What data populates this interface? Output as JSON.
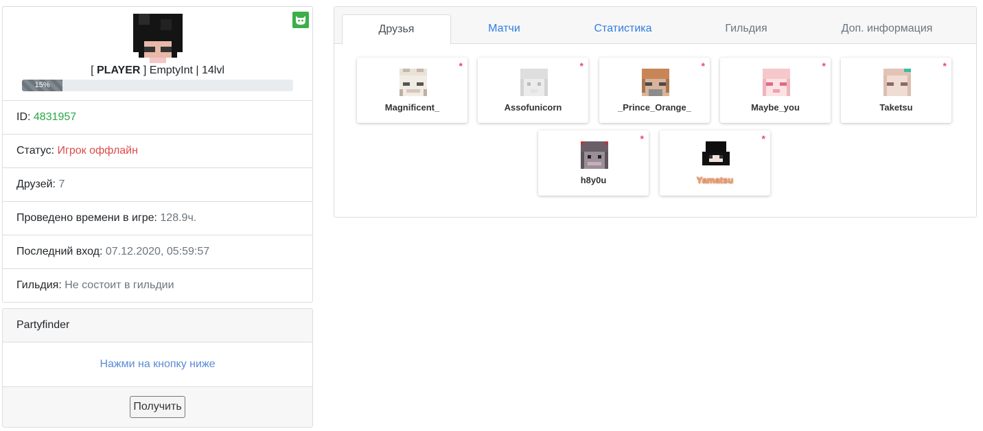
{
  "profile": {
    "rank": "PLAYER",
    "name_rest": "EmptyInt | 14lvl",
    "xp_percent_label": "15%",
    "xp_fraction": 0.15
  },
  "info": {
    "id_label": "ID:",
    "id_value": "4831957",
    "status_label": "Статус:",
    "status_value": "Игрок оффлайн",
    "friends_label": "Друзей:",
    "friends_value": "7",
    "playtime_label": "Проведено времени в игре:",
    "playtime_value": "128.9ч.",
    "lastlogin_label": "Последний вход:",
    "lastlogin_value": "07.12.2020, 05:59:57",
    "guild_label": "Гильдия:",
    "guild_value": "Не состоит в гильдии"
  },
  "partyfinder": {
    "title": "Partyfinder",
    "hint": "Нажми на кнопку ниже",
    "button": "Получить"
  },
  "tabs": [
    "Друзья",
    "Матчи",
    "Статистика",
    "Гильдия",
    "Доп. информация"
  ],
  "friends": [
    {
      "name": "Magnificent_",
      "star": "*"
    },
    {
      "name": "Assofunicorn",
      "star": "*"
    },
    {
      "name": "_Prince_Orange_",
      "star": "*"
    },
    {
      "name": "Maybe_you",
      "star": "*"
    },
    {
      "name": "Taketsu",
      "star": "*"
    },
    {
      "name": "h8y0u",
      "star": "*"
    },
    {
      "name": "Yamatsu",
      "star": "*"
    }
  ],
  "colors": {
    "accent": "#2f7de1",
    "online_green": "#28a745",
    "offline_red": "#dc4a4a",
    "star": "#e0506a"
  }
}
